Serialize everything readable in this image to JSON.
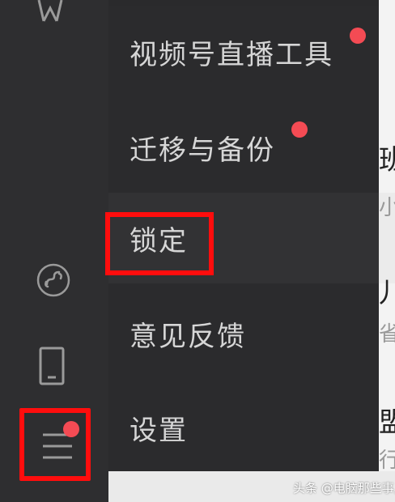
{
  "menu": {
    "items": [
      {
        "label": "视频号直播工具",
        "badge": true
      },
      {
        "label": "迁移与备份",
        "badge": true
      },
      {
        "label": "锁定",
        "badge": false,
        "highlighted": true
      },
      {
        "label": "意见反馈",
        "badge": false
      },
      {
        "label": "设置",
        "badge": false
      }
    ]
  },
  "sidebar": {
    "icons": [
      "film-icon",
      "mini-program-icon",
      "phone-icon",
      "hamburger-menu-icon"
    ],
    "menu_badge": true
  },
  "background": {
    "chars": [
      "班",
      "小",
      "儿",
      "省",
      "盟",
      "行"
    ]
  },
  "watermark": "头条 @电脑那些事儿",
  "colors": {
    "highlight_box": "#ff0d0d",
    "badge": "#f44b54",
    "menu_bg": "#2b2b2d",
    "text": "#d6d6d6"
  }
}
